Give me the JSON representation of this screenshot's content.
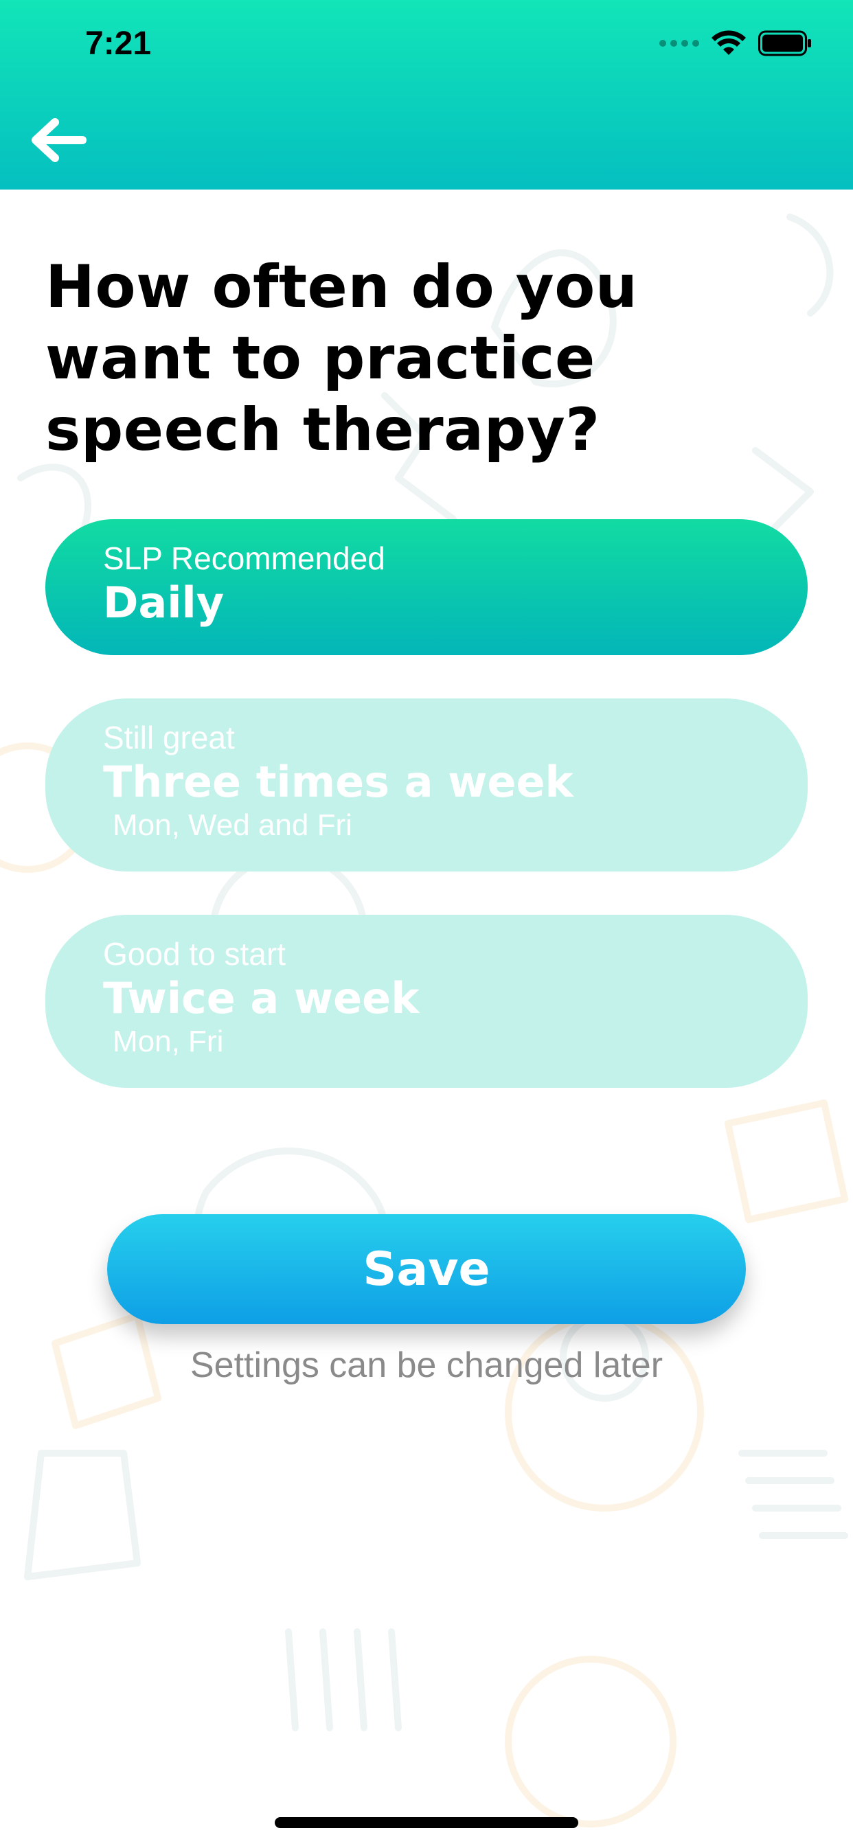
{
  "status_bar": {
    "time": "7:21",
    "icons": [
      "cellular-signal-icon",
      "wifi-icon",
      "battery-icon"
    ]
  },
  "header": {
    "back_icon": "arrow-left-icon",
    "gradient_colors": [
      "#12e5b8",
      "#05bfc0"
    ]
  },
  "main": {
    "title": "How often do you want to practice speech therapy?",
    "options": [
      {
        "subtitle": "SLP Recommended",
        "label": "Daily",
        "days": "",
        "selected": true
      },
      {
        "subtitle": "Still great",
        "label": "Three times a week",
        "days": "Mon, Wed and Fri",
        "selected": false
      },
      {
        "subtitle": "Good to start",
        "label": "Twice a week",
        "days": "Mon, Fri",
        "selected": false
      }
    ],
    "save_label": "Save",
    "hint": "Settings can be changed later"
  },
  "colors": {
    "accent": "#05bfc0",
    "selected_option": "#12dba2",
    "unselected_option": "#c3f2ea",
    "save_button": "#0e9fe6",
    "hint_text": "#8a8a8a"
  }
}
